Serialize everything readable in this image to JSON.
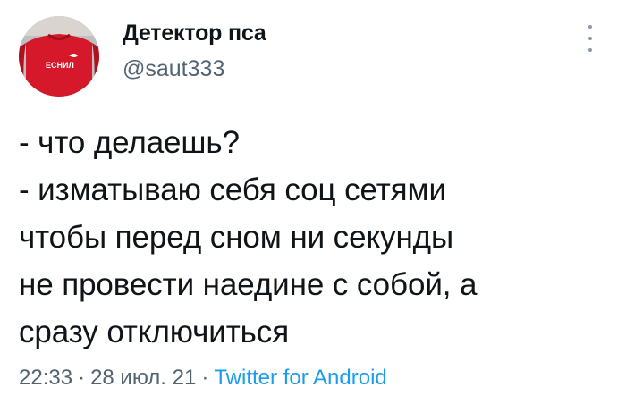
{
  "author": {
    "display_name": "Детектор пса",
    "handle": "@saut333",
    "avatar_icon": "avatar-red-shirt",
    "avatar_shirt_text": "ЕСНИЛ"
  },
  "tweet": {
    "lines": [
      "- что делаешь?",
      "- изматываю себя соц сетями",
      "чтобы перед сном ни секунды",
      "не провести наедине с собой, а",
      "сразу отключиться"
    ]
  },
  "meta": {
    "time": "22:33",
    "separator": "·",
    "date": "28 июл. 21",
    "source": "Twitter for Android"
  },
  "icons": {
    "more": "more-vertical-icon"
  },
  "colors": {
    "text": "#0f1419",
    "secondary": "#536471",
    "link": "#1d9bf0",
    "avatar_shirt": "#d5182a"
  }
}
